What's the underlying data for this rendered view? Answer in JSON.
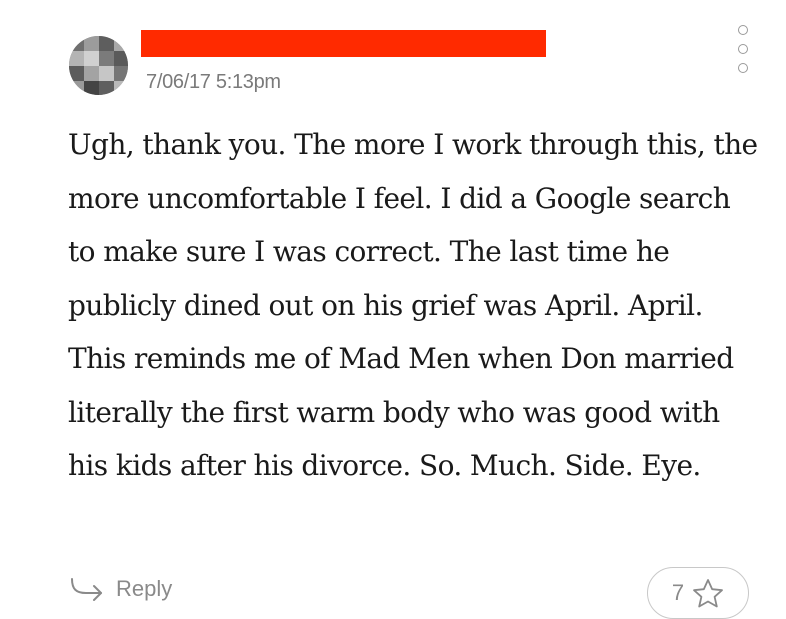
{
  "comment": {
    "timestamp": "7/06/17 5:13pm",
    "body": "Ugh, thank you. The more I work through this, the more uncomfortable I feel. I did a Google search to make sure I was correct. The last time he publicly dined out on his grief was April. April. This reminds me of Mad Men when Don married literally the first warm body who was good with his kids after his divorce. So. Much. Side. Eye.",
    "reply_label": "Reply",
    "like_count": "7"
  },
  "icons": {
    "more_menu": "more-options-icon",
    "reply": "reply-arrow-icon",
    "like": "star-icon"
  },
  "colors": {
    "redaction": "#ff2a00",
    "meta_text": "#7a7a7a",
    "body_text": "#1a1a1a",
    "action_text": "#8a8a8a",
    "pill_border": "#c8c8c8"
  }
}
